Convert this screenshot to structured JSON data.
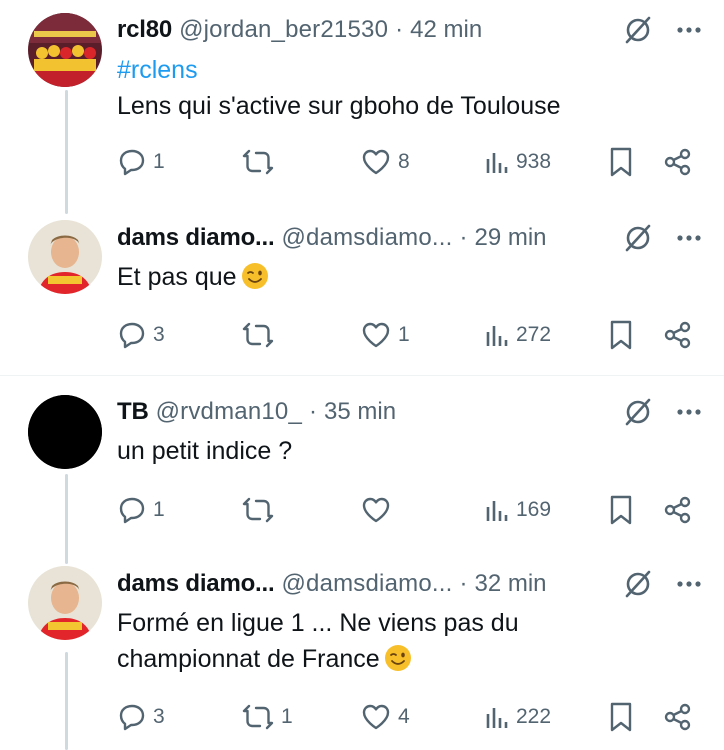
{
  "tweets": [
    {
      "name": "rcl80",
      "handle": "@jordan_ber21530",
      "dot": "·",
      "time": "42 min",
      "hashtag": "#rclens",
      "text": "Lens qui s'active sur gboho de Toulouse",
      "replies": "1",
      "retweets": "",
      "likes": "8",
      "views": "938"
    },
    {
      "name": "dams diamo...",
      "handle": "@damsdiamo...",
      "dot": "·",
      "time": "29 min",
      "text": "Et pas que",
      "emoji": "winking-face",
      "replies": "3",
      "retweets": "",
      "likes": "1",
      "views": "272"
    },
    {
      "name": "TB",
      "handle": "@rvdman10_",
      "dot": "·",
      "time": "35 min",
      "text": "un petit indice ?",
      "replies": "1",
      "retweets": "",
      "likes": "",
      "views": "169"
    },
    {
      "name": "dams diamo...",
      "handle": "@damsdiamo...",
      "dot": "·",
      "time": "32 min",
      "text_line1": "Formé en ligue 1 ... Ne viens pas du",
      "text_line2": "championnat de France",
      "emoji": "winking-face",
      "replies": "3",
      "retweets": "1",
      "likes": "4",
      "views": "222"
    }
  ],
  "colors": {
    "text": "#0f1419",
    "secondary": "#536471",
    "link": "#1d9bf0",
    "thread_line": "#cfd9de",
    "divider": "#eff3f4"
  },
  "icons": [
    "reply-icon",
    "retweet-icon",
    "like-icon",
    "views-icon",
    "bookmark-icon",
    "share-icon",
    "grok-icon",
    "more-icon"
  ]
}
